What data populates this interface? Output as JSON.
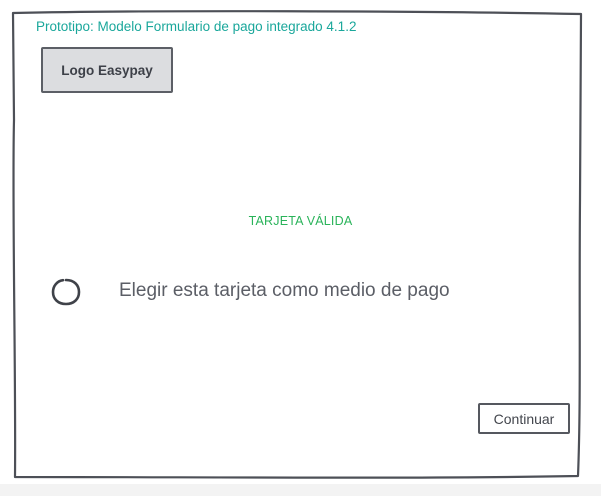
{
  "prototype": {
    "title": "Prototipo: Modelo Formulario de pago integrado 4.1.2"
  },
  "logo": {
    "label": "Logo Easypay"
  },
  "card_status": {
    "text": "TARJETA VÁLIDA"
  },
  "payment_choice": {
    "label": "Elegir esta tarjeta como medio de pago",
    "selected": false
  },
  "actions": {
    "continue_label": "Continuar"
  },
  "colors": {
    "title": "#1aa79b",
    "status_valid": "#2ab35a",
    "frame": "#4d5057",
    "logo_fill": "#dcdde0"
  }
}
